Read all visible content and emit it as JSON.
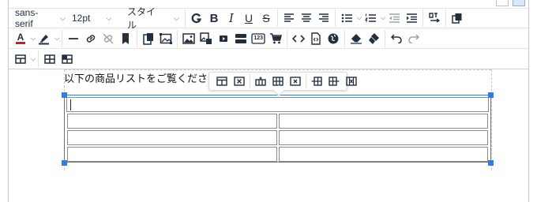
{
  "toolbar": {
    "font_family": "sans-serif",
    "font_size": "12pt",
    "style": "スタイル",
    "bold": "B",
    "italic": "I",
    "underline": "U",
    "strike": "S",
    "text_color_letter": "A",
    "code_label": "123"
  },
  "editor": {
    "paragraph": "以下の商品リストをご覧ください。"
  },
  "colors": {
    "accent": "#3c7bd6",
    "handle": "#2f7ce6",
    "text_color_bar": "#d21c1c",
    "border": "#c4c4c4"
  },
  "icons": [
    "bold-icon",
    "align-left-icon",
    "align-center-icon",
    "align-right-icon",
    "bullet-list-icon",
    "numbered-list-icon",
    "outdent-icon",
    "indent-icon",
    "text-direction-icon",
    "copy-format-icon",
    "text-color-icon",
    "highlight-icon",
    "horizontal-rule-icon",
    "link-icon",
    "unlink-icon",
    "bookmark-icon",
    "paste-icon",
    "image-crop-icon",
    "image-icon",
    "image-edit-icon",
    "media-icon",
    "template-icon",
    "shopping-cart-icon",
    "code-icon",
    "file-code-icon",
    "globe-icon",
    "eraser-icon",
    "paint-brush-icon",
    "undo-icon",
    "redo-icon",
    "table-icon",
    "table-insert-icon",
    "table-merge-icon"
  ]
}
